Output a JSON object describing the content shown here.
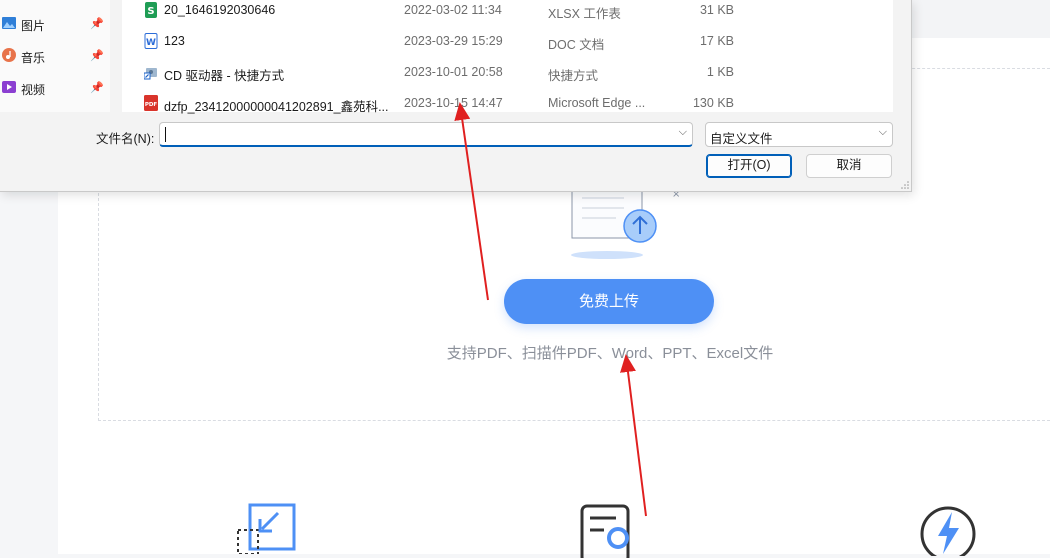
{
  "nav": {
    "items": [
      {
        "label": "图片",
        "icon": "pictures-icon"
      },
      {
        "label": "音乐",
        "icon": "music-icon"
      },
      {
        "label": "视频",
        "icon": "videos-icon"
      }
    ],
    "pin_glyph": "📌"
  },
  "files": [
    {
      "name": "20_1646192030646",
      "date": "2022-03-02 11:34",
      "type": "XLSX 工作表",
      "size": "31 KB",
      "icon": "xlsx-file-icon"
    },
    {
      "name": "123",
      "date": "2023-03-29 15:29",
      "type": "DOC 文档",
      "size": "17 KB",
      "icon": "doc-file-icon"
    },
    {
      "name": "CD 驱动器 - 快捷方式",
      "date": "2023-10-01 20:58",
      "type": "快捷方式",
      "size": "1 KB",
      "icon": "shortcut-icon"
    },
    {
      "name": "dzfp_23412000000041202891_鑫苑科...",
      "date": "2023-10-15 14:47",
      "type": "Microsoft Edge ...",
      "size": "130 KB",
      "icon": "pdf-file-icon"
    }
  ],
  "dialog": {
    "filename_label": "文件名(N):",
    "filename_value": "",
    "filetype_value": "自定义文件",
    "open_label": "打开(O)",
    "cancel_label": "取消"
  },
  "upload": {
    "button_label": "免费上传",
    "hint": "支持PDF、扫描件PDF、Word、PPT、Excel文件"
  },
  "colors": {
    "accent": "#4e90f5",
    "dialog_focus": "#005fb8",
    "arrow": "#e02020"
  }
}
